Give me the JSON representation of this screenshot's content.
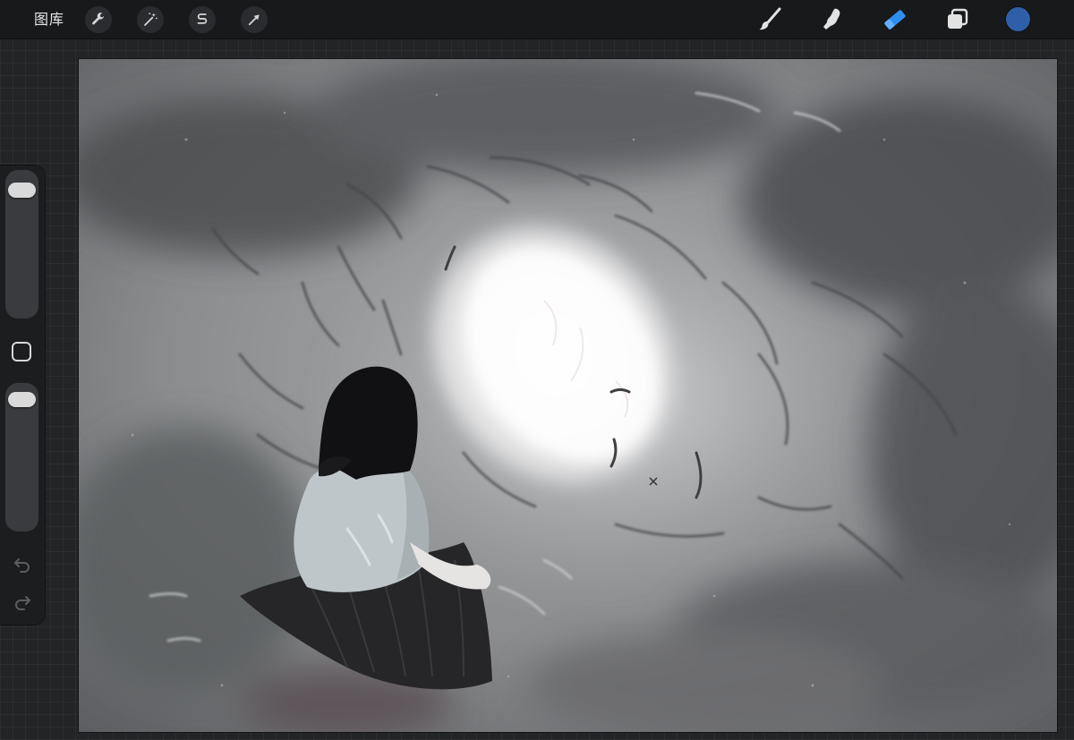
{
  "toolbar": {
    "gallery_label": "图库",
    "left_tools": [
      {
        "name": "actions",
        "icon": "wrench-icon"
      },
      {
        "name": "adjustments",
        "icon": "magic-wand-icon"
      },
      {
        "name": "selection",
        "icon": "selection-s-icon"
      },
      {
        "name": "transform",
        "icon": "arrow-cursor-icon"
      }
    ],
    "right_tools": [
      {
        "name": "brush",
        "icon": "brush-icon",
        "active": false
      },
      {
        "name": "smudge",
        "icon": "smudge-finger-icon",
        "active": false
      },
      {
        "name": "eraser",
        "icon": "eraser-icon",
        "active": true
      },
      {
        "name": "layers",
        "icon": "layers-icon",
        "active": false
      }
    ],
    "current_color": "#2f5fa8",
    "active_tool_color": "#2e8ff0"
  },
  "sidebar": {
    "brush_size_level": 0.92,
    "opacity_level": 0.95,
    "modify_button_icon": "square-outline-icon",
    "undo_icon": "undo-icon",
    "redo_icon": "redo-icon"
  },
  "canvas": {
    "artwork": "monochrome-watercolor-painting",
    "icon": "canvas-artwork"
  }
}
